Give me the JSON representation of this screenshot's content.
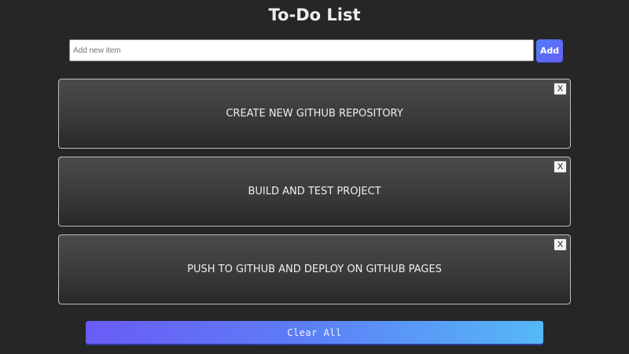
{
  "app": {
    "title": "To-Do List"
  },
  "new_item": {
    "placeholder": "Add new item",
    "value": "",
    "add_label": "Add"
  },
  "items": [
    {
      "text": "CREATE NEW GITHUB REPOSITORY",
      "delete_label": "X"
    },
    {
      "text": "BUILD AND TEST PROJECT",
      "delete_label": "X"
    },
    {
      "text": "PUSH TO GITHUB AND DEPLOY ON GITHUB PAGES",
      "delete_label": "X"
    }
  ],
  "footer": {
    "clear_all_label": "Clear All"
  },
  "colors": {
    "background": "#262626",
    "accent_start": "#6a5cf6",
    "accent_end": "#55b8f6",
    "add_button": "#5b6cf6"
  }
}
